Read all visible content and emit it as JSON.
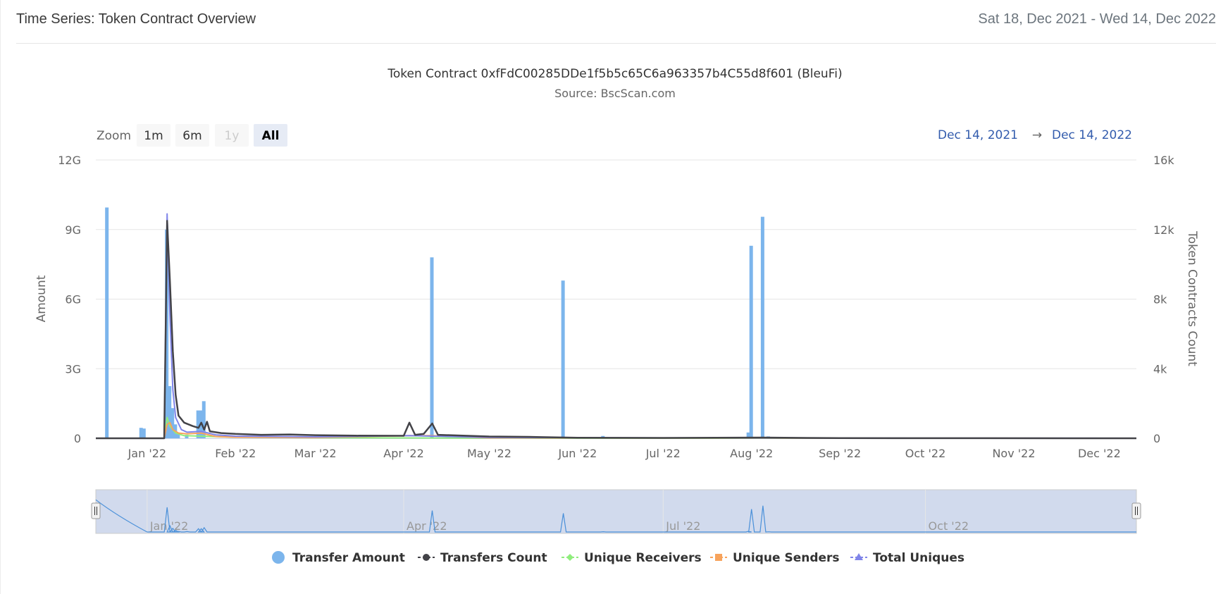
{
  "header": {
    "title": "Time Series: Token Contract Overview",
    "date_range": "Sat 18, Dec 2021 - Wed 14, Dec 2022"
  },
  "range_selector": {
    "label": "Zoom",
    "buttons": [
      {
        "label": "1m",
        "state": "normal"
      },
      {
        "label": "6m",
        "state": "normal"
      },
      {
        "label": "1y",
        "state": "disabled"
      },
      {
        "label": "All",
        "state": "selected"
      }
    ],
    "from": "Dec 14, 2021",
    "arrow": "→",
    "to": "Dec 14, 2022"
  },
  "navigator": {
    "labels": [
      "Jan '22",
      "Apr '22",
      "Jul '22",
      "Oct '22"
    ]
  },
  "chart_data": {
    "type": "bar",
    "title": "Token Contract 0xfFdC00285DDe1f5b5c65C6a963357b4C55d8f601 (BleuFi)",
    "subtitle": "Source: BscScan.com",
    "x_range": [
      "2021-12-14",
      "2022-12-14"
    ],
    "x_ticks": [
      {
        "date": "2022-01-01",
        "label": "Jan '22"
      },
      {
        "date": "2022-02-01",
        "label": "Feb '22"
      },
      {
        "date": "2022-03-01",
        "label": "Mar '22"
      },
      {
        "date": "2022-04-01",
        "label": "Apr '22"
      },
      {
        "date": "2022-05-01",
        "label": "May '22"
      },
      {
        "date": "2022-06-01",
        "label": "Jun '22"
      },
      {
        "date": "2022-07-01",
        "label": "Jul '22"
      },
      {
        "date": "2022-08-01",
        "label": "Aug '22"
      },
      {
        "date": "2022-09-01",
        "label": "Sep '22"
      },
      {
        "date": "2022-10-01",
        "label": "Oct '22"
      },
      {
        "date": "2022-11-01",
        "label": "Nov '22"
      },
      {
        "date": "2022-12-01",
        "label": "Dec '22"
      }
    ],
    "y_left": {
      "label": "Amount",
      "range": [
        0,
        12000000000
      ],
      "ticks": [
        {
          "value": 0,
          "label": "0"
        },
        {
          "value": 3000000000,
          "label": "3G"
        },
        {
          "value": 6000000000,
          "label": "6G"
        },
        {
          "value": 9000000000,
          "label": "9G"
        },
        {
          "value": 12000000000,
          "label": "12G"
        }
      ]
    },
    "y_right": {
      "label": "Token Contracts Count",
      "range": [
        0,
        16000
      ],
      "ticks": [
        {
          "value": 0,
          "label": "0"
        },
        {
          "value": 4000,
          "label": "4k"
        },
        {
          "value": 8000,
          "label": "8k"
        },
        {
          "value": 12000,
          "label": "12k"
        },
        {
          "value": 16000,
          "label": "16k"
        }
      ]
    },
    "grid": true,
    "legend_position": "bottom-center",
    "series": [
      {
        "name": "Transfer Amount",
        "type": "column",
        "axis": "left",
        "color": "#7cb5ec",
        "marker": "circle",
        "points": [
          [
            "2021-12-18",
            9950000000
          ],
          [
            "2021-12-30",
            450000000
          ],
          [
            "2021-12-31",
            420000000
          ],
          [
            "2022-01-08",
            9000000000
          ],
          [
            "2022-01-09",
            2250000000
          ],
          [
            "2022-01-10",
            1300000000
          ],
          [
            "2022-01-11",
            600000000
          ],
          [
            "2022-01-12",
            200000000
          ],
          [
            "2022-01-15",
            150000000
          ],
          [
            "2022-01-19",
            1200000000
          ],
          [
            "2022-01-20",
            1200000000
          ],
          [
            "2022-01-21",
            1600000000
          ],
          [
            "2022-04-11",
            7800000000
          ],
          [
            "2022-05-27",
            6800000000
          ],
          [
            "2022-06-10",
            100000000
          ],
          [
            "2022-07-31",
            250000000
          ],
          [
            "2022-08-01",
            8300000000
          ],
          [
            "2022-08-05",
            9550000000
          ],
          [
            "2022-08-07",
            80000000
          ]
        ]
      },
      {
        "name": "Transfers Count",
        "type": "line",
        "axis": "right",
        "color": "#434348",
        "marker": "circle",
        "points": [
          [
            "2021-12-14",
            0
          ],
          [
            "2022-01-07",
            0
          ],
          [
            "2022-01-08",
            12500
          ],
          [
            "2022-01-09",
            9000
          ],
          [
            "2022-01-10",
            5000
          ],
          [
            "2022-01-11",
            2500
          ],
          [
            "2022-01-12",
            1300
          ],
          [
            "2022-01-14",
            900
          ],
          [
            "2022-01-17",
            700
          ],
          [
            "2022-01-19",
            600
          ],
          [
            "2022-01-20",
            900
          ],
          [
            "2022-01-21",
            500
          ],
          [
            "2022-01-22",
            950
          ],
          [
            "2022-01-23",
            400
          ],
          [
            "2022-01-27",
            300
          ],
          [
            "2022-02-01",
            250
          ],
          [
            "2022-02-10",
            200
          ],
          [
            "2022-02-20",
            220
          ],
          [
            "2022-03-01",
            180
          ],
          [
            "2022-03-15",
            150
          ],
          [
            "2022-04-01",
            140
          ],
          [
            "2022-04-03",
            900
          ],
          [
            "2022-04-05",
            200
          ],
          [
            "2022-04-08",
            250
          ],
          [
            "2022-04-11",
            850
          ],
          [
            "2022-04-13",
            200
          ],
          [
            "2022-05-01",
            100
          ],
          [
            "2022-05-15",
            80
          ],
          [
            "2022-06-01",
            30
          ],
          [
            "2022-07-01",
            20
          ],
          [
            "2022-08-05",
            40
          ],
          [
            "2022-09-01",
            10
          ],
          [
            "2022-12-14",
            0
          ]
        ]
      },
      {
        "name": "Unique Receivers",
        "type": "line",
        "axis": "right",
        "color": "#90ed7d",
        "marker": "diamond",
        "points": [
          [
            "2021-12-14",
            0
          ],
          [
            "2022-01-07",
            0
          ],
          [
            "2022-01-08",
            1200
          ],
          [
            "2022-01-09",
            700
          ],
          [
            "2022-01-11",
            300
          ],
          [
            "2022-01-14",
            150
          ],
          [
            "2022-02-01",
            60
          ],
          [
            "2022-03-01",
            30
          ],
          [
            "2022-05-01",
            10
          ],
          [
            "2022-12-14",
            0
          ]
        ]
      },
      {
        "name": "Unique Senders",
        "type": "line",
        "axis": "right",
        "color": "#f7a35c",
        "marker": "square",
        "points": [
          [
            "2021-12-14",
            0
          ],
          [
            "2022-01-07",
            0
          ],
          [
            "2022-01-08",
            800
          ],
          [
            "2022-01-09",
            900
          ],
          [
            "2022-01-10",
            500
          ],
          [
            "2022-01-12",
            300
          ],
          [
            "2022-01-15",
            250
          ],
          [
            "2022-01-20",
            300
          ],
          [
            "2022-01-25",
            100
          ],
          [
            "2022-02-01",
            60
          ],
          [
            "2022-03-01",
            40
          ],
          [
            "2022-04-03",
            150
          ],
          [
            "2022-04-11",
            150
          ],
          [
            "2022-05-01",
            20
          ],
          [
            "2022-12-14",
            0
          ]
        ]
      },
      {
        "name": "Total Uniques",
        "type": "line",
        "axis": "right",
        "color": "#8085e9",
        "marker": "triangle",
        "points": [
          [
            "2021-12-14",
            0
          ],
          [
            "2022-01-07",
            0
          ],
          [
            "2022-01-08",
            12900
          ],
          [
            "2022-01-09",
            7000
          ],
          [
            "2022-01-10",
            2800
          ],
          [
            "2022-01-11",
            1200
          ],
          [
            "2022-01-13",
            500
          ],
          [
            "2022-01-15",
            350
          ],
          [
            "2022-01-20",
            400
          ],
          [
            "2022-01-25",
            200
          ],
          [
            "2022-02-01",
            120
          ],
          [
            "2022-03-01",
            80
          ],
          [
            "2022-04-03",
            150
          ],
          [
            "2022-05-01",
            50
          ],
          [
            "2022-07-01",
            20
          ],
          [
            "2022-12-14",
            0
          ]
        ]
      }
    ]
  }
}
